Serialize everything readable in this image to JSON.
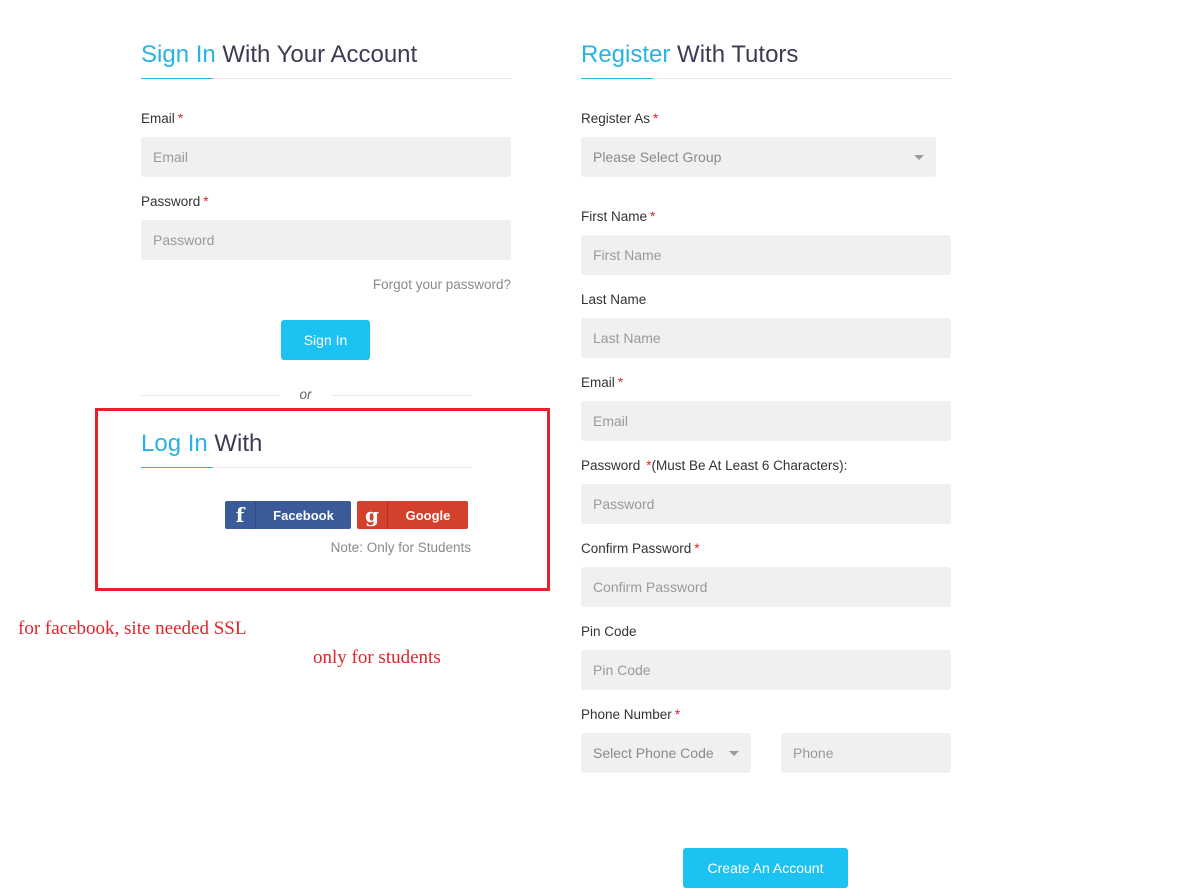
{
  "signin": {
    "heading_accent": "Sign In",
    "heading_rest": " With Your Account",
    "email_label": "Email",
    "email_placeholder": "Email",
    "password_label": "Password",
    "password_placeholder": "Password",
    "forgot_link": "Forgot your password?",
    "submit_label": "Sign In",
    "or_text": "or"
  },
  "social_login": {
    "heading_accent": "Log In",
    "heading_rest": " With",
    "facebook_label": "Facebook",
    "google_label": "Google",
    "facebook_icon": "f",
    "google_icon": "g",
    "note": "Note: Only for Students"
  },
  "annotations": {
    "ssl_note": "for facebook, site needed SSL",
    "students_note": "only for students"
  },
  "register": {
    "heading_accent": "Register",
    "heading_rest": " With Tutors",
    "register_as_label": "Register As",
    "register_as_value": "Please Select Group",
    "first_name_label": "First Name",
    "first_name_placeholder": "First Name",
    "last_name_label": "Last Name",
    "last_name_placeholder": "Last Name",
    "email_label": "Email",
    "email_placeholder": "Email",
    "password_label": "Password",
    "password_hint": "(Must Be At Least 6 Characters):",
    "password_placeholder": "Password",
    "confirm_label": "Confirm Password",
    "confirm_placeholder": "Confirm Password",
    "pin_label": "Pin Code",
    "pin_placeholder": "Pin Code",
    "phone_label": "Phone Number",
    "phone_code_value": "Select Phone Code",
    "phone_placeholder": "Phone",
    "submit_label": "Create An Account"
  },
  "required_mark": "*",
  "colors": {
    "accent": "#29b3e3",
    "button": "#1cc3f2",
    "required": "#e3222b",
    "annotation": "#e3222b",
    "facebook": "#3b5a9a",
    "google": "#d3402c"
  }
}
